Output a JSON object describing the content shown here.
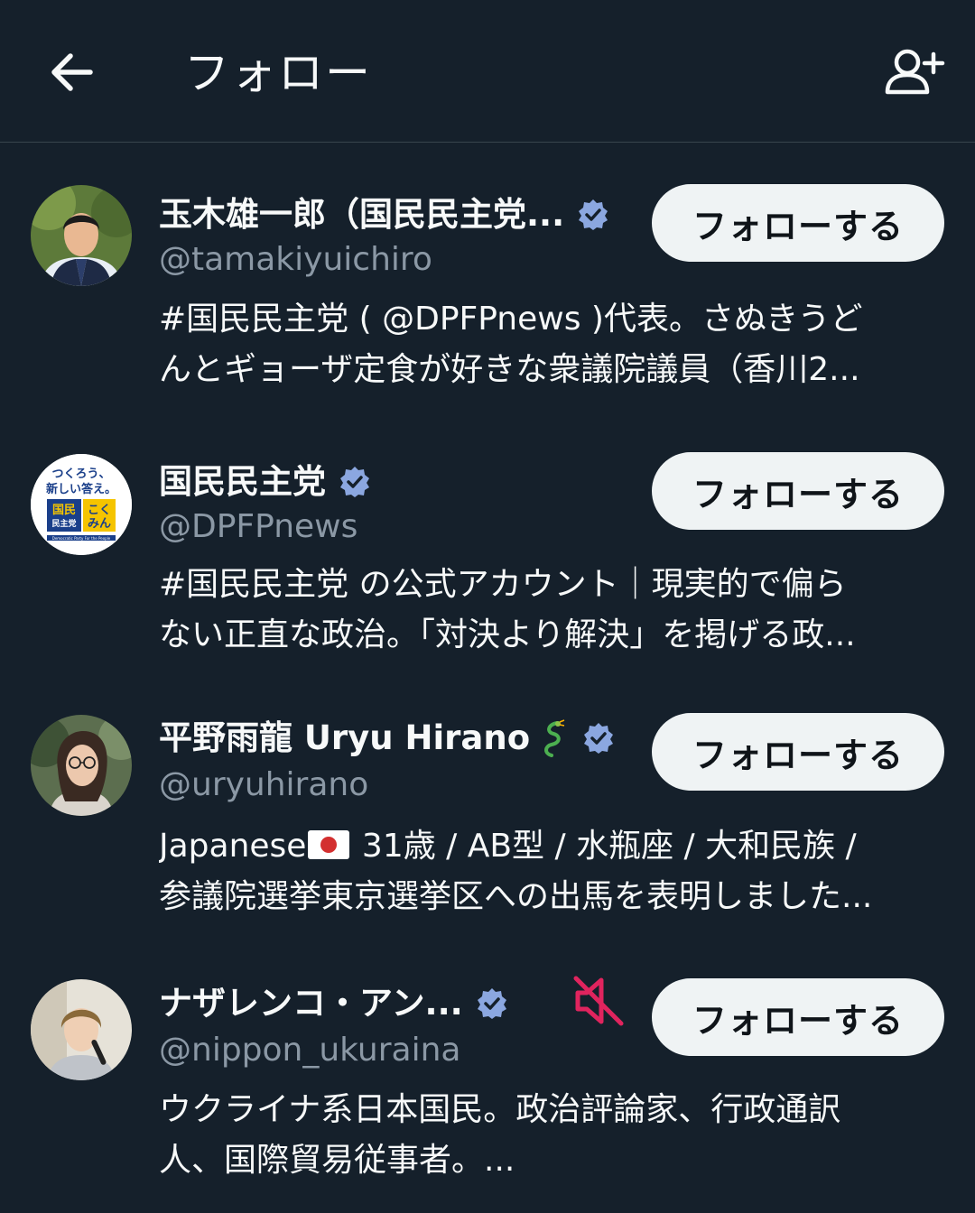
{
  "header": {
    "title": "フォロー",
    "back_icon": "arrow-left-icon",
    "add_icon": "person-add-icon"
  },
  "colors": {
    "background": "#15202b",
    "text_primary": "#f7f9f9",
    "text_secondary": "#8b98a5",
    "verified_badge": "#8ba7e0",
    "button_bg": "#eff3f4",
    "muted_icon": "#e0245e"
  },
  "users": [
    {
      "name": "玉木雄一郎（国民民主党...",
      "handle": "@tamakiyuichiro",
      "bio_line1": "#国民民主党 ( @DPFPnews )代表。さぬきうど",
      "bio_line2": "んとギョーザ定食が好きな衆議院議員（香川2...",
      "verified": true,
      "follow_label": "フォローする"
    },
    {
      "name": "国民民主党",
      "handle": "@DPFPnews",
      "bio_line1": "#国民民主党 の公式アカウント｜現実的で偏ら",
      "bio_line2": "ない正直な政治。「対決より解決」を掲げる政...",
      "verified": true,
      "follow_label": "フォローする",
      "avatar_text": {
        "line1": "つくろう、",
        "line2": "新しい答え。",
        "box1": "国民",
        "box1b": "民主党",
        "box2": "こく",
        "box2b": "みん",
        "footer": "Democratic Party For the People"
      }
    },
    {
      "name": "平野雨龍 Uryu Hirano",
      "handle": "@uryuhirano",
      "bio_prefix": "Japanese",
      "bio_line1_rest": " 31歳 / AB型 / 水瓶座 / 大和民族 /",
      "bio_line2": "参議院選挙東京選挙区への出馬を表明しました...",
      "emoji": "dragon-icon",
      "verified": true,
      "follow_label": "フォローする"
    },
    {
      "name": "ナザレンコ・アン...",
      "handle": "@nippon_ukuraina",
      "bio_line1": "ウクライナ系日本国民。政治評論家、行政通訳",
      "bio_line2": "人、国際貿易従事者。...",
      "verified": true,
      "muted": true,
      "muted_icon": "speaker-muted-icon",
      "follow_label": "フォローする"
    }
  ]
}
